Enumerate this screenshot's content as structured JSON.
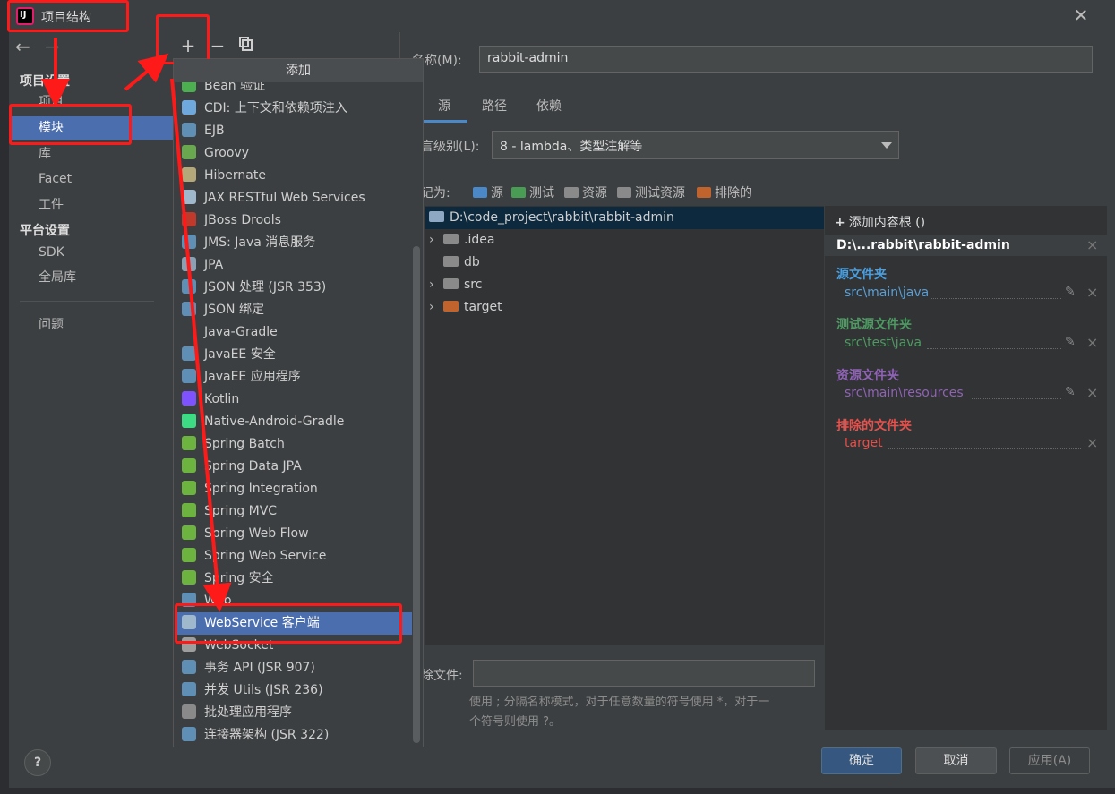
{
  "window": {
    "title": "项目结构",
    "app_icon_label": "IJ"
  },
  "sidebar": {
    "project_settings_heading": "项目设置",
    "project_items": [
      "项目",
      "模块",
      "库",
      "Facet",
      "工件"
    ],
    "platform_heading": "平台设置",
    "platform_items": [
      "SDK",
      "全局库"
    ],
    "problems": "问题",
    "selected": "模块"
  },
  "toolbar": {
    "add": "+",
    "remove": "−"
  },
  "popup": {
    "title": "添加",
    "items": [
      {
        "label": "Bean 验证",
        "icon_color": "#4caf50"
      },
      {
        "label": "CDI: 上下文和依赖项注入",
        "icon_color": "#6fa8dc"
      },
      {
        "label": "EJB",
        "icon_color": "#5f8fb5"
      },
      {
        "label": "Groovy",
        "icon_color": "#6aa84f"
      },
      {
        "label": "Hibernate",
        "icon_color": "#b4a77a"
      },
      {
        "label": "JAX RESTful Web Services",
        "icon_color": "#9fb8cc"
      },
      {
        "label": "JBoss Drools",
        "icon_color": "#c0392b"
      },
      {
        "label": "JMS: Java 消息服务",
        "icon_color": "#5f8fb5"
      },
      {
        "label": "JPA",
        "icon_color": "#8aa0b4"
      },
      {
        "label": "JSON 处理 (JSR 353)",
        "icon_color": "#5f8fb5"
      },
      {
        "label": "JSON 绑定",
        "icon_color": "#5f8fb5"
      },
      {
        "label": "Java-Gradle",
        "icon_color": "#3c3f41"
      },
      {
        "label": "JavaEE 安全",
        "icon_color": "#5f8fb5"
      },
      {
        "label": "JavaEE 应用程序",
        "icon_color": "#5f8fb5"
      },
      {
        "label": "Kotlin",
        "icon_color": "#7f52ff"
      },
      {
        "label": "Native-Android-Gradle",
        "icon_color": "#3ddc84"
      },
      {
        "label": "Spring Batch",
        "icon_color": "#6db33f"
      },
      {
        "label": "Spring Data JPA",
        "icon_color": "#6db33f"
      },
      {
        "label": "Spring Integration",
        "icon_color": "#6db33f"
      },
      {
        "label": "Spring MVC",
        "icon_color": "#6db33f"
      },
      {
        "label": "Spring Web Flow",
        "icon_color": "#6db33f"
      },
      {
        "label": "Spring Web Service",
        "icon_color": "#6db33f"
      },
      {
        "label": "Spring 安全",
        "icon_color": "#6db33f"
      },
      {
        "label": "Web",
        "icon_color": "#5f8fb5"
      },
      {
        "label": "WebService 客户端",
        "icon_color": "#9fb8cc"
      },
      {
        "label": "WebSocket",
        "icon_color": "#9e9e9e"
      },
      {
        "label": "事务 API (JSR 907)",
        "icon_color": "#5f8fb5"
      },
      {
        "label": "并发 Utils (JSR 236)",
        "icon_color": "#5f8fb5"
      },
      {
        "label": "批处理应用程序",
        "icon_color": "#8a8a8a"
      },
      {
        "label": "连接器架构 (JSR 322)",
        "icon_color": "#5f8fb5"
      }
    ],
    "selected": "WebService 客户端"
  },
  "main": {
    "name_label": "名称(M):",
    "name_value": "rabbit-admin",
    "tabs": [
      "源",
      "路径",
      "依赖"
    ],
    "language_level_label": "言级别(L):",
    "language_level_value": "8 - lambda、类型注解等",
    "mark_as_label": "记为:",
    "mark_as": [
      {
        "label": "源",
        "color": "#4a88c7"
      },
      {
        "label": "测试",
        "color": "#499c54"
      },
      {
        "label": "资源",
        "color": "#8a8a8a"
      },
      {
        "label": "测试资源",
        "color": "#8a8a8a"
      },
      {
        "label": "排除的",
        "color": "#c0632c"
      }
    ],
    "tree": [
      {
        "label": "D:\\code_project\\rabbit\\rabbit-admin",
        "color": "#8ea7c2",
        "expandable": false,
        "level": 0
      },
      {
        "label": ".idea",
        "color": "#8a8a8a",
        "expandable": true,
        "level": 1
      },
      {
        "label": "db",
        "color": "#8a8a8a",
        "expandable": false,
        "level": 1
      },
      {
        "label": "src",
        "color": "#8a8a8a",
        "expandable": true,
        "level": 1
      },
      {
        "label": "target",
        "color": "#c0632c",
        "expandable": true,
        "level": 1
      }
    ],
    "exclude_label": "除文件:",
    "exclude_hint_line1": "使用 ; 分隔名称模式，对于任意数量的符号使用 *，对于一",
    "exclude_hint_line2": "个符号则使用 ?。"
  },
  "content_root": {
    "add_label": "添加内容根 ()",
    "root": "D:\\...rabbit\\rabbit-admin",
    "sections": [
      {
        "title": "源文件夹",
        "path": "src\\main\\java",
        "title_color": "#4a9fe0",
        "path_color": "#5a9fd6",
        "editable": true
      },
      {
        "title": "测试源文件夹",
        "path": "src\\test\\java",
        "title_color": "#4e9a62",
        "path_color": "#4e9a62",
        "editable": true
      },
      {
        "title": "资源文件夹",
        "path": "src\\main\\resources",
        "title_color": "#9063b5",
        "path_color": "#9063b5",
        "editable": true
      },
      {
        "title": "排除的文件夹",
        "path": "target",
        "title_color": "#e8504b",
        "path_color": "#e8504b",
        "editable": false
      }
    ]
  },
  "buttons": {
    "ok": "确定",
    "cancel": "取消",
    "apply": "应用(A)",
    "help": "?"
  },
  "annotation_color": "#ff1a1a"
}
